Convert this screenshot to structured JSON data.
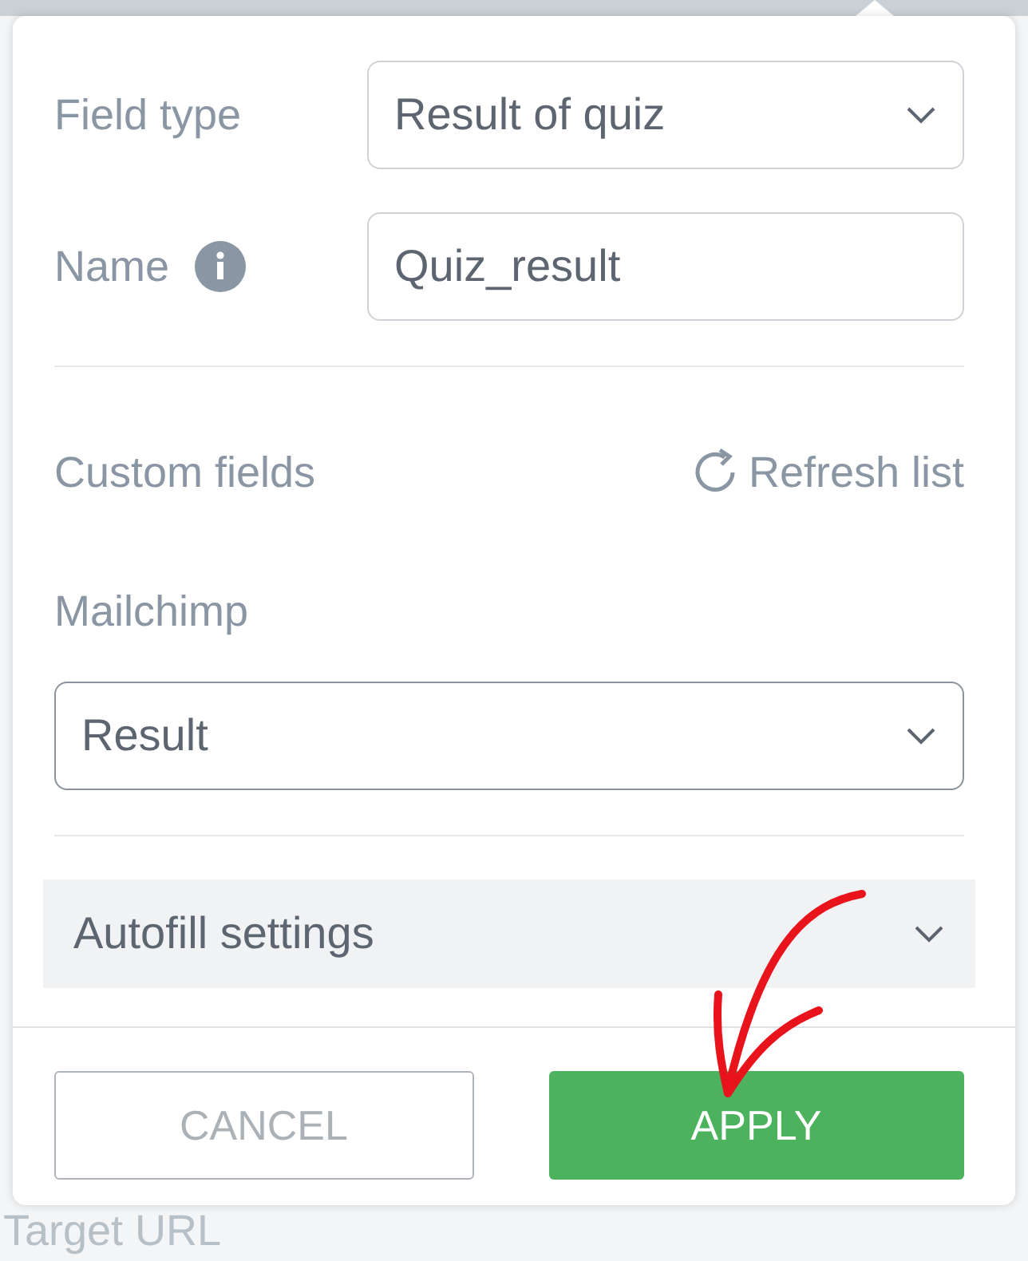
{
  "form": {
    "field_type": {
      "label": "Field type",
      "value": "Result of quiz"
    },
    "name": {
      "label": "Name",
      "value": "Quiz_result"
    },
    "custom_fields": {
      "label": "Custom fields",
      "refresh": "Refresh list"
    },
    "mailchimp": {
      "label": "Mailchimp",
      "value": "Result"
    },
    "autofill": {
      "label": "Autofill settings",
      "expanded": false
    }
  },
  "buttons": [
    {
      "label": "CANCEL",
      "kind": "secondary"
    },
    {
      "label": "APPLY",
      "kind": "primary"
    }
  ],
  "background": {
    "label": "Target URL"
  }
}
